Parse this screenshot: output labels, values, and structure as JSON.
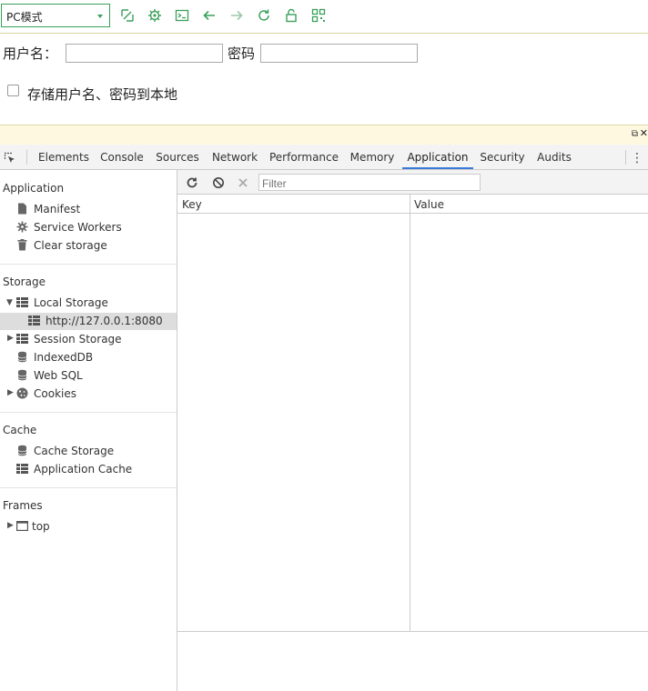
{
  "toolbar": {
    "mode_select": "PC模式",
    "icons": [
      "screenshot-icon",
      "gear-icon",
      "terminal-icon",
      "back-arrow-icon",
      "forward-arrow-icon",
      "refresh-icon",
      "lock-icon",
      "qr-code-icon"
    ],
    "accent": "#3aa05a"
  },
  "login": {
    "username_label": "用户名：",
    "username_value": "",
    "password_label": "密码",
    "password_value": "",
    "remember_label": "存储用户名、密码到本地",
    "remember_checked": false
  },
  "devtools": {
    "tabs": [
      "Elements",
      "Console",
      "Sources",
      "Network",
      "Performance",
      "Memory",
      "Application",
      "Security",
      "Audits"
    ],
    "active_tab": "Application",
    "sidebar": {
      "application": {
        "title": "Application",
        "items": [
          "Manifest",
          "Service Workers",
          "Clear storage"
        ]
      },
      "storage": {
        "title": "Storage",
        "local_storage": "Local Storage",
        "local_origin": "http://127.0.0.1:8080",
        "session_storage": "Session Storage",
        "indexeddb": "IndexedDB",
        "websql": "Web SQL",
        "cookies": "Cookies"
      },
      "cache": {
        "title": "Cache",
        "items": [
          "Cache Storage",
          "Application Cache"
        ]
      },
      "frames": {
        "title": "Frames",
        "top": "top"
      }
    },
    "main": {
      "filter_placeholder": "Filter",
      "col_key": "Key",
      "col_value": "Value"
    }
  }
}
